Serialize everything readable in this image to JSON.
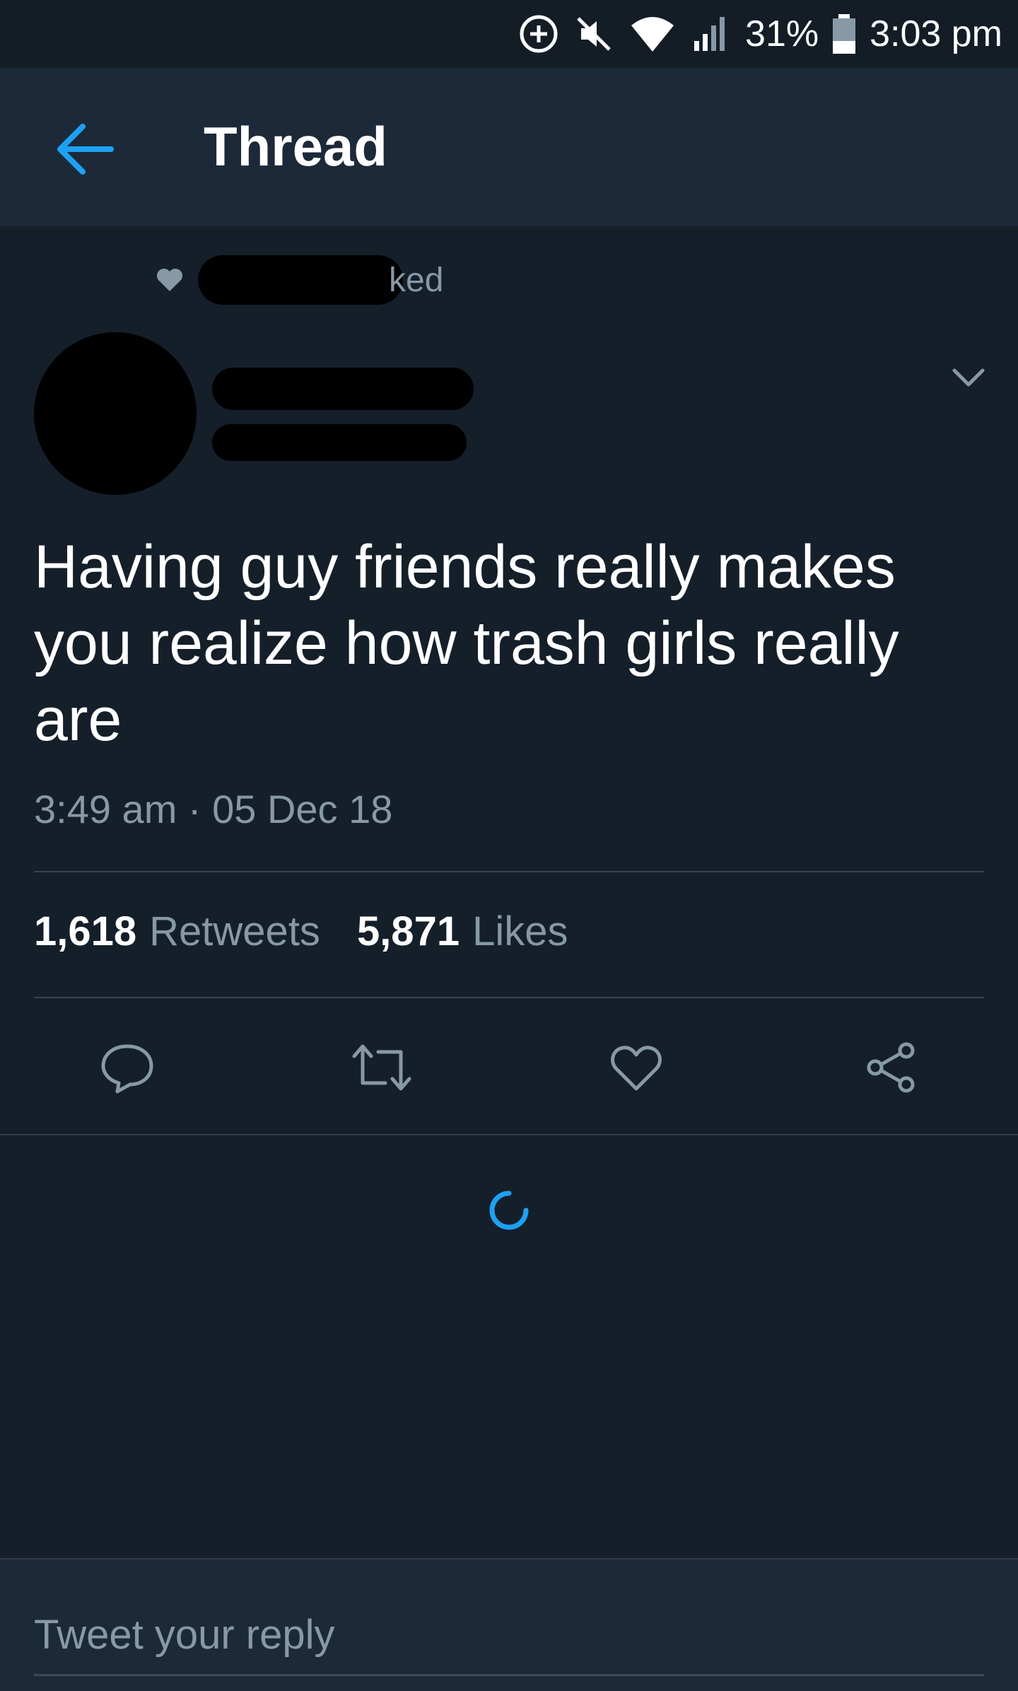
{
  "status_bar": {
    "battery": "31%",
    "time": "3:03 pm"
  },
  "app_bar": {
    "title": "Thread",
    "back_icon": "arrow-left-icon"
  },
  "social_context": {
    "icon": "heart-icon",
    "label_suffix": "ked"
  },
  "tweet": {
    "text": "Having guy friends really makes you realize how trash girls really are",
    "timestamp": "3:49 am · 05 Dec 18",
    "retweets_count": "1,618",
    "retweets_label": "Retweets",
    "likes_count": "5,871",
    "likes_label": "Likes"
  },
  "actions": [
    {
      "icon": "reply-icon"
    },
    {
      "icon": "retweet-icon"
    },
    {
      "icon": "heart-icon"
    },
    {
      "icon": "share-icon"
    }
  ],
  "reply": {
    "placeholder": "Tweet your reply"
  },
  "colors": {
    "accent": "#1da1f2",
    "background": "#151f2a",
    "bar": "#1c2939",
    "secondary_text": "#8899a6"
  }
}
